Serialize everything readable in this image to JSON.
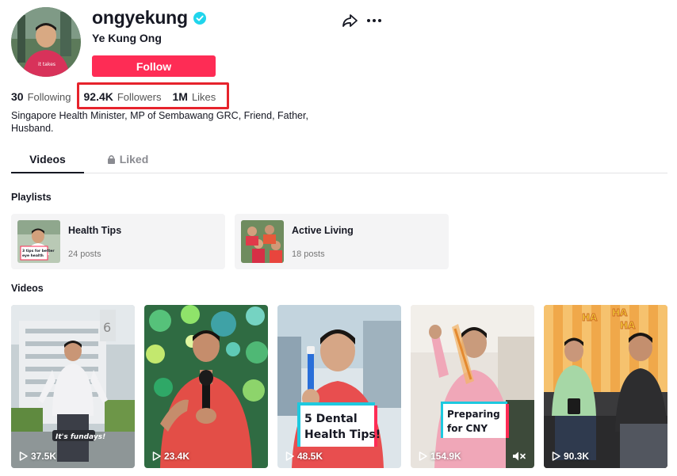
{
  "profile": {
    "username": "ongyekung",
    "nickname": "Ye Kung Ong",
    "follow_label": "Follow",
    "bio": "Singapore Health Minister, MP of Sembawang GRC, Friend, Father, Husband."
  },
  "stats": {
    "following_count": "30",
    "following_label": "Following",
    "followers_count": "92.4K",
    "followers_label": "Followers",
    "likes_count": "1M",
    "likes_label": "Likes"
  },
  "tabs": {
    "videos": "Videos",
    "liked": "Liked"
  },
  "playlists": {
    "title": "Playlists",
    "items": [
      {
        "title": "Health Tips",
        "count": "24 posts",
        "thumb_text": "3 tips for better eye health"
      },
      {
        "title": "Active Living",
        "count": "18 posts"
      }
    ]
  },
  "videos": {
    "title": "Videos",
    "items": [
      {
        "views": "37.5K",
        "overlay": "It's fundays!"
      },
      {
        "views": "23.4K"
      },
      {
        "views": "48.5K",
        "overlay": "5 Dental Health Tips!"
      },
      {
        "views": "154.9K",
        "overlay": "Preparing for CNY"
      },
      {
        "views": "90.3K",
        "overlay": "HA HA HA"
      }
    ]
  },
  "colors": {
    "accent": "#fe2c55",
    "verified": "#20d5ec",
    "highlight": "#e6232c"
  },
  "icons": [
    "verified-icon",
    "share-icon",
    "more-icon",
    "lock-icon",
    "play-icon",
    "mute-icon"
  ]
}
